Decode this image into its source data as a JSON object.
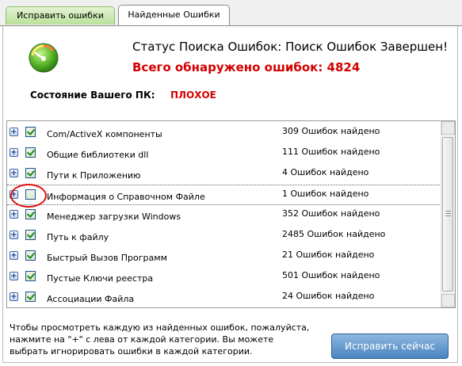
{
  "tabs": [
    {
      "label": "Исправить ошибки"
    },
    {
      "label": "Найденные Ошибки"
    }
  ],
  "status": {
    "title": "Статус Поиска Ошибок: Поиск Ошибок Завершен!",
    "errors_found": "Всего обнаружено ошибок: 4824",
    "pc_state_label": "Состояние Вашего ПК:",
    "pc_state_value": "ПЛОХОЕ"
  },
  "categories": [
    {
      "name": "Com/ActiveX компоненты",
      "count": "309 Ошибок найдено",
      "checked": true
    },
    {
      "name": "Общие библиотеки dll",
      "count": "111 Ошибок найдено",
      "checked": true
    },
    {
      "name": "Пути к Приложению",
      "count": "4 Ошибок найдено",
      "checked": true
    },
    {
      "name": "Информация о Справочном Файле",
      "count": "1 Ошибок найдено",
      "checked": false
    },
    {
      "name": "Менеджер загрузки Windows",
      "count": "352 Ошибок найдено",
      "checked": true
    },
    {
      "name": "Путь к файлу",
      "count": "2485 Ошибок найдено",
      "checked": true
    },
    {
      "name": "Быстрый Вызов Программ",
      "count": "21 Ошибок найдено",
      "checked": true
    },
    {
      "name": "Пустые Ключи реестра",
      "count": "501 Ошибок найдено",
      "checked": true
    },
    {
      "name": "Ассоциации Файла",
      "count": "24 Ошибок найдено",
      "checked": true
    }
  ],
  "expand_symbol": "+",
  "footer": {
    "note": "Чтобы просмотреть каждую из найденных ошибок, пожалуйста, нажмите на \"+\" с лева от каждой категории. Вы можете выбрать игнорировать ошибки в каждой категории.",
    "fix_button": "Исправить сейчас"
  },
  "colors": {
    "accent_red": "#d40000",
    "button_blue": "#4a84c0",
    "tab_green": "#b9e09a"
  },
  "icons": [
    "gauge-icon",
    "plus-expand-icon",
    "checkbox-icon",
    "scroll-up-icon",
    "scroll-down-icon"
  ]
}
